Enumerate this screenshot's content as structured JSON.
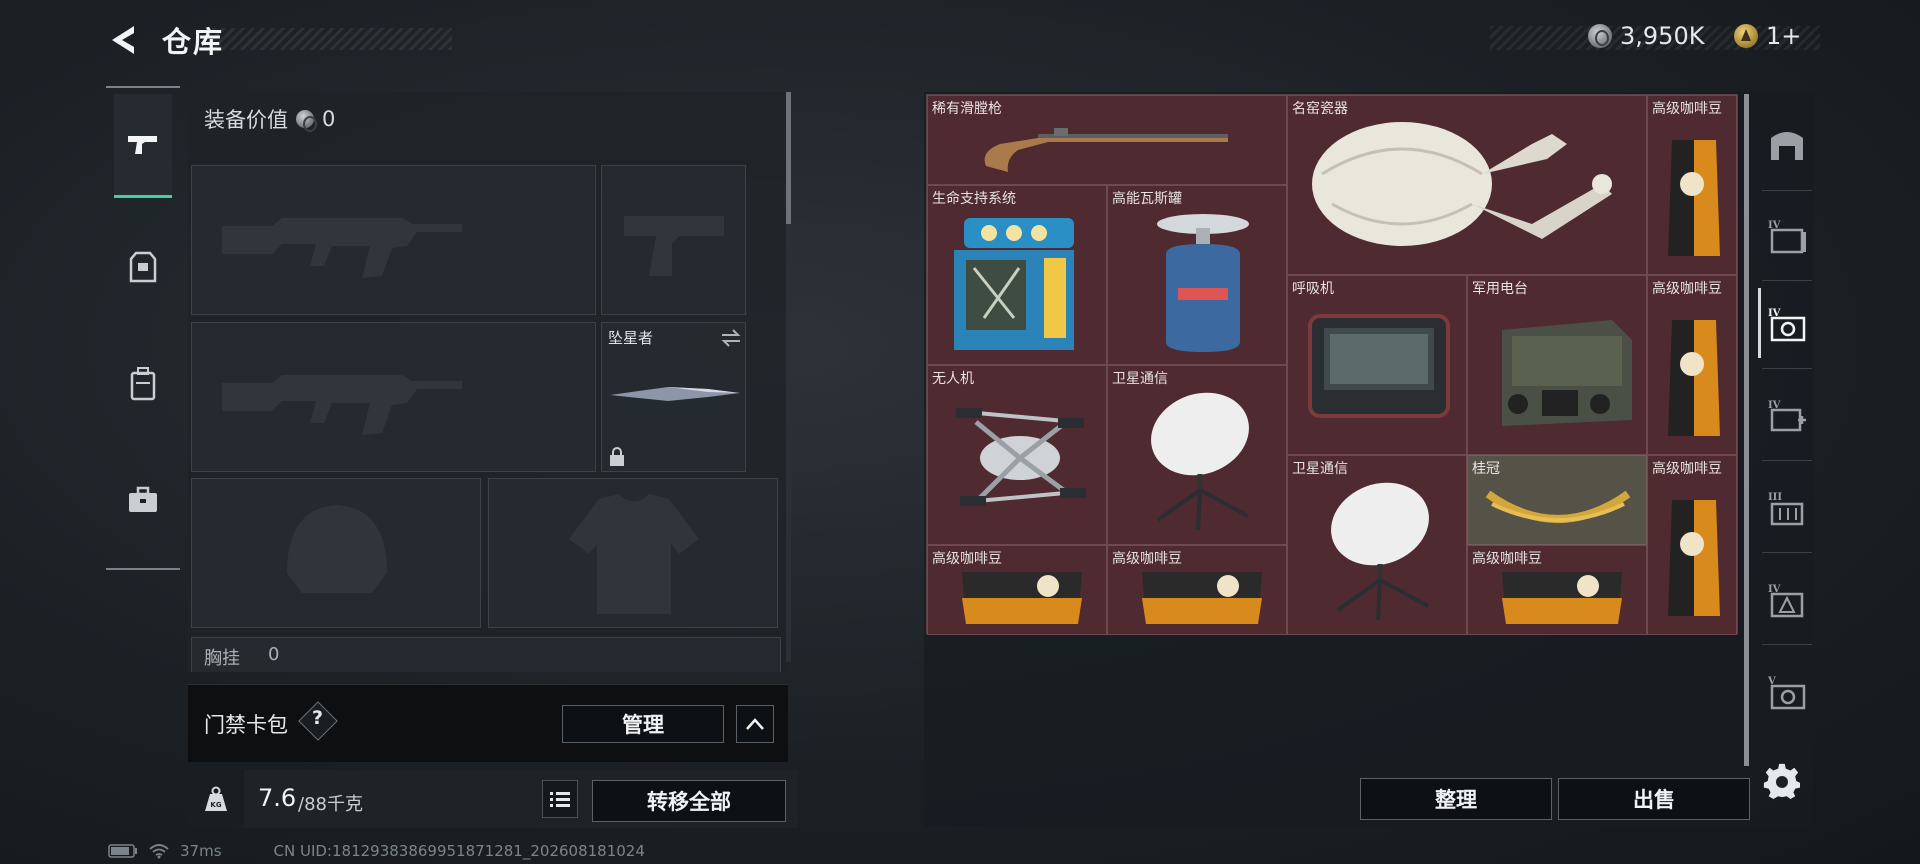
{
  "header": {
    "title": "仓库"
  },
  "currency": {
    "coins": "3,950K",
    "tickets": "1+"
  },
  "equipment": {
    "value_label": "装备价值",
    "value": "0",
    "melee_name": "坠星者",
    "chest_rig_label": "胸挂",
    "chest_rig_value": "0"
  },
  "keycard": {
    "label": "门禁卡包",
    "help": "?",
    "manage_label": "管理"
  },
  "weight": {
    "current": "7.6",
    "max": "/88千克",
    "transfer_all_label": "转移全部"
  },
  "status": {
    "ping": "37ms",
    "uid": "CN UID:18129383869951871281_202608181024"
  },
  "storage": {
    "items": [
      {
        "name": "稀有滑膛枪"
      },
      {
        "name": "名窑瓷器"
      },
      {
        "name": "高级咖啡豆"
      },
      {
        "name": "生命支持系统"
      },
      {
        "name": "高能瓦斯罐"
      },
      {
        "name": "呼吸机"
      },
      {
        "name": "军用电台"
      },
      {
        "name": "高级咖啡豆"
      },
      {
        "name": "无人机"
      },
      {
        "name": "卫星通信"
      },
      {
        "name": "卫星通信"
      },
      {
        "name": "桂冠"
      },
      {
        "name": "高级咖啡豆"
      },
      {
        "name": "高级咖啡豆"
      },
      {
        "name": "高级咖啡豆"
      },
      {
        "name": "高级咖啡豆"
      }
    ],
    "sort_label": "整理",
    "sell_label": "出售"
  },
  "right_categories": [
    "warehouse",
    "tier-iv",
    "tier-iv",
    "tier-iv",
    "tier-iii",
    "tier-iv",
    "tier-v"
  ],
  "colors": {
    "accent": "#3fd1a0",
    "grid_bg": "#4f2a31"
  }
}
